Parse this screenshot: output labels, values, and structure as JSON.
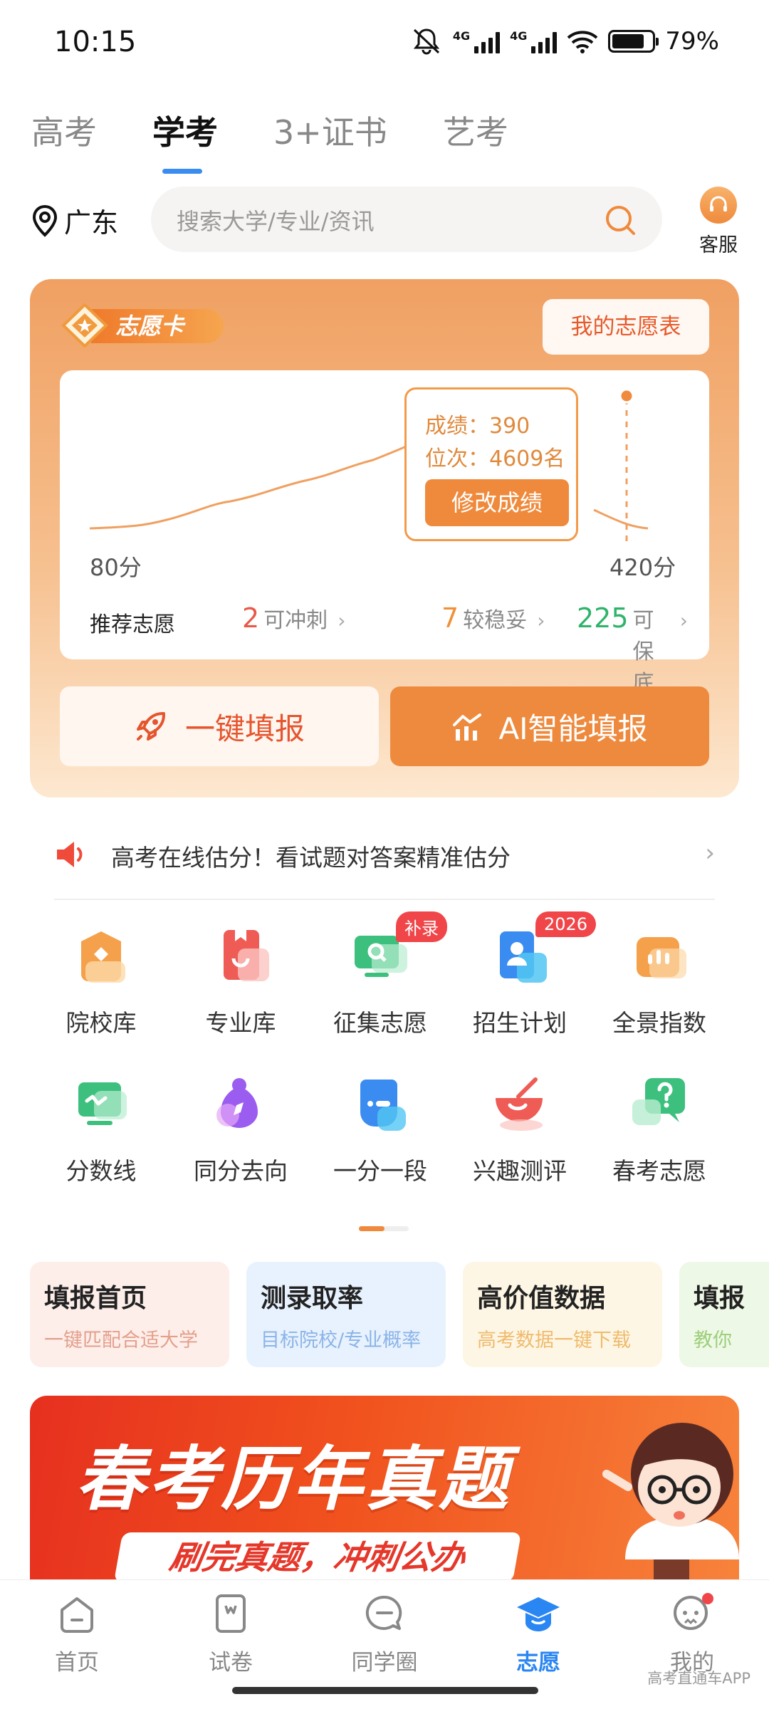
{
  "status_bar": {
    "time": "10:15",
    "battery": "79%",
    "network1": "4G",
    "network2": "4G"
  },
  "tabs": [
    {
      "label": "高考",
      "active": false
    },
    {
      "label": "学考",
      "active": true
    },
    {
      "label": "3+证书",
      "active": false
    },
    {
      "label": "艺考",
      "active": false
    }
  ],
  "location": "广东",
  "search": {
    "placeholder": "搜索大学/专业/资讯"
  },
  "service": {
    "label": "客服"
  },
  "wish_card": {
    "badge": "志愿卡",
    "my_form": "我的志愿表",
    "score_line": "成绩：390",
    "rank_line": "位次：4609名",
    "edit_button": "修改成绩",
    "x_min_label": "80分",
    "x_max_label": "420分",
    "recommend_label": "推荐志愿",
    "stats": [
      {
        "count": "2",
        "label": "可冲刺",
        "color": "#e8594a"
      },
      {
        "count": "7",
        "label": "较稳妥",
        "color": "#f0913a"
      },
      {
        "count": "225",
        "label": "可保底",
        "color": "#2fb36a"
      }
    ],
    "one_click": "一键填报",
    "ai_fill": "AI智能填报"
  },
  "notice": {
    "text": "高考在线估分！看试题对答案精准估分"
  },
  "grid": [
    {
      "label": "院校库",
      "icon": "school-icon",
      "color": "#f5a04a"
    },
    {
      "label": "专业库",
      "icon": "book-icon",
      "color": "#ef5b55"
    },
    {
      "label": "征集志愿",
      "icon": "search-monitor-icon",
      "color": "#3dc07e",
      "badge": "补录"
    },
    {
      "label": "招生计划",
      "icon": "person-card-icon",
      "color": "#3a8cf0",
      "badge": "2026"
    },
    {
      "label": "全景指数",
      "icon": "bar-chart-icon",
      "color": "#f5a04a"
    },
    {
      "label": "分数线",
      "icon": "line-monitor-icon",
      "color": "#3dc07e"
    },
    {
      "label": "同分去向",
      "icon": "direction-icon",
      "color": "#9b5cf0"
    },
    {
      "label": "一分一段",
      "icon": "segment-icon",
      "color": "#3a8cf0"
    },
    {
      "label": "兴趣测评",
      "icon": "bowl-icon",
      "color": "#ef5b55"
    },
    {
      "label": "春考志愿",
      "icon": "question-chat-icon",
      "color": "#3dc07e"
    }
  ],
  "quick_cards": [
    {
      "title": "填报首页",
      "desc": "一键匹配合适大学",
      "bg": "#fdeeea",
      "desc_color": "#e3a08c"
    },
    {
      "title": "测录取率",
      "desc": "目标院校/专业概率",
      "bg": "#e8f2fe",
      "desc_color": "#8bb4e8"
    },
    {
      "title": "高价值数据",
      "desc": "高考数据一键下载",
      "bg": "#fef6e4",
      "desc_color": "#efbb6e"
    },
    {
      "title": "填报",
      "desc": "教你",
      "bg": "#eef8e6",
      "desc_color": "#9ccf7a"
    }
  ],
  "banner": {
    "title": "春考历年真题",
    "subtitle": "刷完真题，冲刺公办"
  },
  "tab_bar": [
    {
      "label": "首页",
      "icon": "home-icon",
      "active": false
    },
    {
      "label": "试卷",
      "icon": "paper-icon",
      "active": false
    },
    {
      "label": "同学圈",
      "icon": "chat-icon",
      "active": false
    },
    {
      "label": "志愿",
      "icon": "graduation-cap-icon",
      "active": true
    },
    {
      "label": "我的",
      "icon": "profile-icon",
      "active": false
    }
  ],
  "watermark": "高考直通车APP"
}
